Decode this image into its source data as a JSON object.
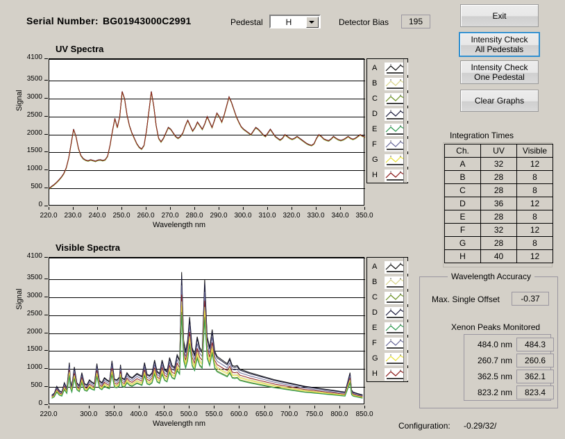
{
  "header": {
    "serial_label": "Serial Number:",
    "serial_value": "BG01943000C2991",
    "pedestal_label": "Pedestal",
    "pedestal_value": "H",
    "pedestal_options": [
      "A",
      "B",
      "C",
      "D",
      "E",
      "F",
      "G",
      "H"
    ],
    "detector_bias_label": "Detector Bias",
    "detector_bias_value": "195"
  },
  "buttons": {
    "exit": "Exit",
    "intensity_all_line1": "Intensity Check",
    "intensity_all_line2": "All Pedestals",
    "intensity_one_line1": "Intensity Check",
    "intensity_one_line2": "One Pedestal",
    "clear_graphs": "Clear Graphs"
  },
  "integration_times": {
    "title": "Integration Times",
    "columns": [
      "Ch.",
      "UV",
      "Visible"
    ],
    "rows": [
      [
        "A",
        "32",
        "12"
      ],
      [
        "B",
        "28",
        "8"
      ],
      [
        "C",
        "28",
        "8"
      ],
      [
        "D",
        "36",
        "12"
      ],
      [
        "E",
        "28",
        "8"
      ],
      [
        "F",
        "32",
        "12"
      ],
      [
        "G",
        "28",
        "8"
      ],
      [
        "H",
        "40",
        "12"
      ]
    ]
  },
  "wavelength_accuracy": {
    "title": "Wavelength Accuracy",
    "max_single_offset_label": "Max. Single Offset",
    "max_single_offset_value": "-0.37",
    "xenon_title": "Xenon Peaks Monitored",
    "peaks": [
      {
        "nominal": "484.0 nm",
        "measured": "484.3"
      },
      {
        "nominal": "260.7 nm",
        "measured": "260.6"
      },
      {
        "nominal": "362.5 nm",
        "measured": "362.1"
      },
      {
        "nominal": "823.2 nm",
        "measured": "823.4"
      }
    ]
  },
  "footer": {
    "configuration_label": "Configuration:",
    "configuration_value": "-0.29/32/"
  },
  "legend": {
    "channels": [
      "A",
      "B",
      "C",
      "D",
      "E",
      "F",
      "G",
      "H"
    ],
    "colors": [
      "#101010",
      "#d8d48a",
      "#6a8f20",
      "#1a1a3c",
      "#2e9a4e",
      "#6a6a9a",
      "#e8e03a",
      "#8a1818"
    ]
  },
  "chart_data": [
    {
      "type": "line",
      "title": "UV Spectra",
      "xlabel": "Wavelength nm",
      "ylabel": "Signal",
      "xlim": [
        220.0,
        350.0
      ],
      "ylim": [
        0,
        4100
      ],
      "xticks": [
        220.0,
        230.0,
        240.0,
        250.0,
        260.0,
        270.0,
        280.0,
        290.0,
        300.0,
        310.0,
        320.0,
        330.0,
        340.0,
        350.0
      ],
      "xticklabels": [
        "220.0",
        "230.0",
        "240.0",
        "250.0",
        "260.0",
        "270.0",
        "280.0",
        "290.0",
        "300.0",
        "310.0",
        "320.0",
        "330.0",
        "340.0",
        "350.0"
      ],
      "yticks": [
        0,
        500,
        1000,
        1500,
        2000,
        2500,
        3000,
        3500,
        4100
      ],
      "yticklabels": [
        "0",
        "500",
        "1000",
        "1500",
        "2000",
        "2500",
        "3000",
        "3500",
        "4100"
      ],
      "grid": true,
      "legend_position": "right",
      "series": [
        {
          "name": "A",
          "color": "#101010",
          "offset": 0
        },
        {
          "name": "B",
          "color": "#d8d48a",
          "offset": 14
        },
        {
          "name": "C",
          "color": "#6a8f20",
          "offset": 20
        },
        {
          "name": "D",
          "color": "#1a1a3c",
          "offset": 4
        },
        {
          "name": "E",
          "color": "#2e9a4e",
          "offset": 18
        },
        {
          "name": "F",
          "color": "#6a6a9a",
          "offset": 8
        },
        {
          "name": "G",
          "color": "#e8e03a",
          "offset": 12
        },
        {
          "name": "H",
          "color": "#8a1818",
          "offset": 6
        }
      ],
      "x": [
        220,
        221,
        222,
        223,
        224,
        225,
        226,
        227,
        228,
        229,
        230,
        231,
        232,
        233,
        234,
        235,
        236,
        237,
        238,
        239,
        240,
        241,
        242,
        243,
        244,
        245,
        246,
        247,
        248,
        249,
        250,
        251,
        252,
        253,
        254,
        255,
        256,
        257,
        258,
        259,
        260,
        261,
        262,
        263,
        264,
        265,
        266,
        267,
        268,
        269,
        270,
        271,
        272,
        273,
        274,
        275,
        276,
        277,
        278,
        279,
        280,
        281,
        282,
        283,
        284,
        285,
        286,
        287,
        288,
        289,
        290,
        291,
        292,
        293,
        294,
        295,
        296,
        297,
        298,
        299,
        300,
        301,
        302,
        303,
        304,
        305,
        306,
        307,
        308,
        309,
        310,
        311,
        312,
        313,
        314,
        315,
        316,
        317,
        318,
        319,
        320,
        321,
        322,
        323,
        324,
        325,
        326,
        327,
        328,
        329,
        330,
        331,
        332,
        333,
        334,
        335,
        336,
        337,
        338,
        339,
        340,
        341,
        342,
        343,
        344,
        345,
        346,
        347,
        348,
        349,
        350
      ],
      "values": [
        500,
        560,
        610,
        670,
        740,
        820,
        920,
        1080,
        1350,
        1750,
        2150,
        1950,
        1620,
        1420,
        1330,
        1290,
        1270,
        1300,
        1280,
        1260,
        1290,
        1300,
        1280,
        1300,
        1400,
        1700,
        2100,
        2450,
        2200,
        2500,
        3200,
        3000,
        2550,
        2250,
        2050,
        1900,
        1750,
        1650,
        1600,
        1700,
        2100,
        2650,
        3200,
        2800,
        2250,
        1900,
        1800,
        1900,
        2050,
        2200,
        2150,
        2050,
        1950,
        1900,
        1950,
        2050,
        2250,
        2400,
        2250,
        2100,
        2200,
        2350,
        2250,
        2150,
        2300,
        2500,
        2350,
        2200,
        2400,
        2600,
        2500,
        2350,
        2550,
        2800,
        3050,
        2900,
        2700,
        2500,
        2350,
        2220,
        2150,
        2100,
        2050,
        2000,
        2100,
        2200,
        2150,
        2080,
        2000,
        1950,
        2050,
        2150,
        2050,
        1950,
        1900,
        1850,
        1900,
        2000,
        1950,
        1900,
        1870,
        1900,
        1950,
        1900,
        1850,
        1800,
        1750,
        1720,
        1700,
        1750,
        1900,
        2000,
        1950,
        1880,
        1850,
        1830,
        1880,
        1950,
        1900,
        1860,
        1840,
        1860,
        1900,
        1950,
        1900,
        1870,
        1900,
        1950,
        2000,
        1960,
        1930
      ]
    },
    {
      "type": "line",
      "title": "Visible Spectra",
      "xlabel": "Wavelength nm",
      "ylabel": "Signal",
      "xlim": [
        220.0,
        850.0
      ],
      "ylim": [
        0,
        4100
      ],
      "xticks": [
        220.0,
        300.0,
        350.0,
        400.0,
        450.0,
        500.0,
        550.0,
        600.0,
        650.0,
        700.0,
        750.0,
        800.0,
        850.0
      ],
      "xticklabels": [
        "220.0",
        "300.0",
        "350.0",
        "400.0",
        "450.0",
        "500.0",
        "550.0",
        "600.0",
        "650.0",
        "700.0",
        "750.0",
        "800.0",
        "850.0"
      ],
      "yticks": [
        0,
        500,
        1000,
        1500,
        2000,
        2500,
        3000,
        3500,
        4100
      ],
      "yticklabels": [
        "0",
        "500",
        "1000",
        "1500",
        "2000",
        "2500",
        "3000",
        "3500",
        "4100"
      ],
      "grid": true,
      "legend_position": "right",
      "series": [
        {
          "name": "A",
          "color": "#101010",
          "scale": 1.0
        },
        {
          "name": "D",
          "color": "#1a1a3c",
          "scale": 0.97
        },
        {
          "name": "F",
          "color": "#6a6a9a",
          "scale": 0.9
        },
        {
          "name": "H",
          "color": "#8a1818",
          "scale": 0.83
        },
        {
          "name": "B",
          "color": "#d8d48a",
          "scale": 0.78
        },
        {
          "name": "G",
          "color": "#e8e03a",
          "scale": 0.75
        },
        {
          "name": "C",
          "color": "#6a8f20",
          "scale": 0.7
        },
        {
          "name": "E",
          "color": "#2e9a4e",
          "scale": 0.68
        }
      ],
      "x": [
        225,
        230,
        235,
        240,
        245,
        250,
        255,
        260,
        262,
        265,
        270,
        275,
        280,
        285,
        290,
        295,
        300,
        305,
        310,
        315,
        320,
        325,
        330,
        335,
        340,
        345,
        350,
        355,
        360,
        362,
        365,
        370,
        375,
        380,
        385,
        390,
        395,
        400,
        405,
        410,
        415,
        420,
        425,
        430,
        435,
        440,
        445,
        450,
        455,
        460,
        465,
        470,
        475,
        480,
        484,
        488,
        492,
        496,
        500,
        505,
        510,
        515,
        520,
        525,
        530,
        535,
        540,
        545,
        550,
        555,
        560,
        565,
        570,
        575,
        580,
        585,
        590,
        595,
        600,
        610,
        620,
        630,
        640,
        650,
        660,
        670,
        680,
        690,
        700,
        710,
        720,
        730,
        740,
        750,
        760,
        770,
        780,
        790,
        800,
        810,
        820,
        823,
        826,
        830,
        835,
        840,
        845,
        850
      ],
      "values": [
        270,
        330,
        520,
        400,
        360,
        620,
        470,
        1180,
        700,
        520,
        1060,
        620,
        540,
        900,
        600,
        560,
        700,
        640,
        600,
        1150,
        680,
        620,
        760,
        700,
        660,
        1230,
        720,
        700,
        780,
        1120,
        760,
        720,
        900,
        800,
        760,
        820,
        880,
        840,
        800,
        1180,
        860,
        820,
        900,
        1250,
        940,
        880,
        1250,
        1000,
        940,
        1320,
        1100,
        1050,
        1400,
        1250,
        3700,
        1800,
        1500,
        1800,
        2450,
        1600,
        1400,
        1900,
        1600,
        1500,
        3500,
        1900,
        1600,
        2100,
        1500,
        1350,
        1300,
        1250,
        1200,
        1150,
        1300,
        1100,
        1080,
        1100,
        1000,
        950,
        900,
        860,
        820,
        780,
        740,
        700,
        670,
        640,
        610,
        580,
        550,
        520,
        500,
        480,
        460,
        440,
        420,
        400,
        380,
        360,
        900,
        420,
        360,
        340,
        320,
        300,
        280
      ]
    }
  ]
}
